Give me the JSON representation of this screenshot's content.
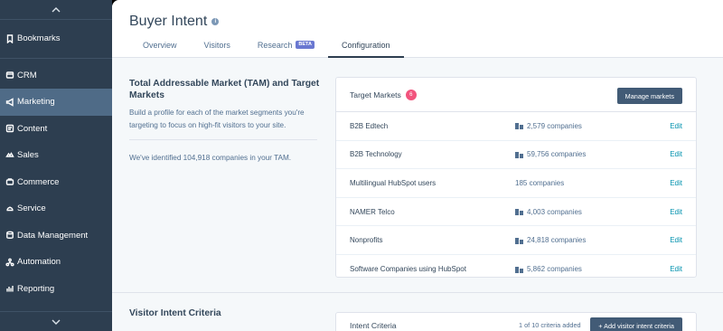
{
  "sidebar": {
    "items_top": [
      {
        "label": "Bookmarks",
        "icon": "bookmark-icon"
      }
    ],
    "items": [
      {
        "label": "CRM",
        "icon": "crm-icon",
        "active": false
      },
      {
        "label": "Marketing",
        "icon": "marketing-icon",
        "active": true
      },
      {
        "label": "Content",
        "icon": "content-icon",
        "active": false
      },
      {
        "label": "Sales",
        "icon": "sales-icon",
        "active": false
      },
      {
        "label": "Commerce",
        "icon": "commerce-icon",
        "active": false
      },
      {
        "label": "Service",
        "icon": "service-icon",
        "active": false
      },
      {
        "label": "Data Management",
        "icon": "data-management-icon",
        "active": false
      },
      {
        "label": "Automation",
        "icon": "automation-icon",
        "active": false
      },
      {
        "label": "Reporting",
        "icon": "reporting-icon",
        "active": false
      }
    ]
  },
  "header": {
    "title": "Buyer Intent",
    "tabs": [
      {
        "label": "Overview",
        "active": false
      },
      {
        "label": "Visitors",
        "active": false
      },
      {
        "label": "Research",
        "active": false,
        "badge": "BETA"
      },
      {
        "label": "Configuration",
        "active": true
      }
    ]
  },
  "tam": {
    "title": "Total Addressable Market (TAM) and Target Markets",
    "description": "Build a profile for each of the market segments you're targeting to focus on high-fit visitors to your site.",
    "identified_text": "We've identified 104,918 companies in your TAM."
  },
  "target_markets": {
    "label": "Target Markets",
    "count": "6",
    "manage_button": "Manage markets",
    "edit_label": "Edit",
    "rows": [
      {
        "name": "B2B Edtech",
        "companies": "2,579 companies"
      },
      {
        "name": "B2B Technology",
        "companies": "59,756 companies"
      },
      {
        "name": "Multilingual HubSpot users",
        "companies": "185 companies"
      },
      {
        "name": "NAMER Telco",
        "companies": "4,003 companies"
      },
      {
        "name": "Nonprofits",
        "companies": "24,818 companies"
      },
      {
        "name": "Software Companies using HubSpot",
        "companies": "5,862 companies"
      }
    ]
  },
  "visitor_intent": {
    "title": "Visitor Intent Criteria",
    "card_label": "Intent Criteria",
    "criteria_count": "1 of 10 criteria added",
    "add_button": "+ Add visitor intent criteria"
  },
  "colors": {
    "sidebar_bg": "#2d3e50",
    "active_item": "#4f6b87",
    "link": "#0091ae",
    "badge": "#f2547d",
    "beta": "#6a78d1"
  }
}
